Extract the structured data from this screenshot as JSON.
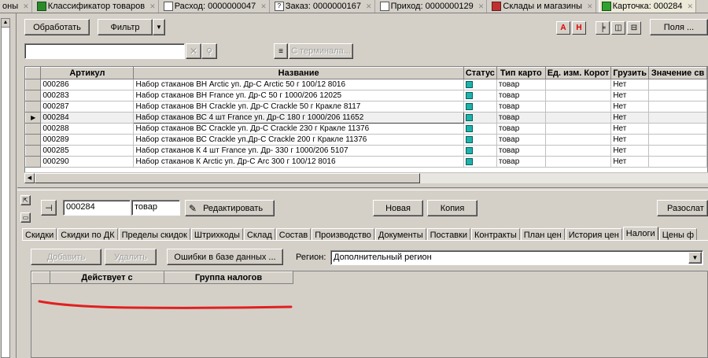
{
  "tabs": [
    {
      "label": "оны",
      "icon": ""
    },
    {
      "label": "Классификатор товаров",
      "icon": "tree"
    },
    {
      "label": "Расход: 0000000047",
      "icon": "doc"
    },
    {
      "label": "Заказ: 0000000167",
      "icon": "q"
    },
    {
      "label": "Приход: 0000000129",
      "icon": "doc"
    },
    {
      "label": "Склады и магазины",
      "icon": "shop"
    },
    {
      "label": "Карточка: 000284",
      "icon": "card"
    }
  ],
  "toolbar": {
    "process": "Обработать",
    "filter": "Фильтр",
    "a_label": "A",
    "h_label": "H",
    "fields": "Поля ...",
    "search_value": "",
    "terminal": "С терминала..."
  },
  "grid": {
    "columns": [
      "Артикул",
      "Название",
      "Статус",
      "Тип карто",
      "Ед. изм. Корот",
      "Грузить",
      "Значение св"
    ],
    "rows": [
      {
        "art": "000286",
        "name": "Набор стаканов ВН  Arctic  уп.  Др-С  Arctic  50 г  100/12  8016",
        "type": "товар",
        "unit": "",
        "load": "Нет"
      },
      {
        "art": "000283",
        "name": "Набор стаканов ВН  France  уп.  Др-С  50 г  1000/206 12025",
        "type": "товар",
        "unit": "",
        "load": "Нет"
      },
      {
        "art": "000287",
        "name": "Набор стаканов ВН Crackle  уп.  Др-С  Crackle  50 г  Кракле 8117",
        "type": "товар",
        "unit": "",
        "load": "Нет"
      },
      {
        "art": "000284",
        "name": "Набор стаканов ВС  4 шт  France  уп.  Др-С  180 г  1000/206  11652",
        "type": "товар",
        "unit": "",
        "load": "Нет"
      },
      {
        "art": "000288",
        "name": "Набор стаканов ВС Crackle  уп.  Др-С  Crackle  230 г  Кракле  11376",
        "type": "товар",
        "unit": "",
        "load": "Нет"
      },
      {
        "art": "000289",
        "name": "Набор стаканов ВС Crackle  уп.Др-С  Crackle  200 г Кракле  11376",
        "type": "товар",
        "unit": "",
        "load": "Нет"
      },
      {
        "art": "000285",
        "name": "Набор стаканов  К  4 шт  France  уп.  Др-  330 г  1000/206  5107",
        "type": "товар",
        "unit": "",
        "load": "Нет"
      },
      {
        "art": "000290",
        "name": "Набор стаканов  К Arctic   уп.  Др-С  Arc  300 г  100/12  8016",
        "type": "товар",
        "unit": "",
        "load": "Нет"
      }
    ]
  },
  "card": {
    "code": "000284",
    "type": "товар",
    "edit": "Редактировать",
    "new": "Новая",
    "copy": "Копия",
    "post": "Разослат"
  },
  "subtabs": [
    "Скидки",
    "Скидки по ДК",
    "Пределы скидок",
    "Штрихкоды",
    "Склад",
    "Состав",
    "Производство",
    "Документы",
    "Поставки",
    "Контракты",
    "План цен",
    "История цен",
    "Налоги",
    "Цены ф"
  ],
  "taxes": {
    "add": "Добавить",
    "delete": "Удалить",
    "errors": "Ошибки в базе данных ...",
    "region_label": "Регион:",
    "region_value": "Дополнительный регион",
    "columns": [
      "Действует с",
      "Группа налогов"
    ]
  },
  "colors": {
    "status": "#20b2aa",
    "annotation": "#e02020"
  }
}
